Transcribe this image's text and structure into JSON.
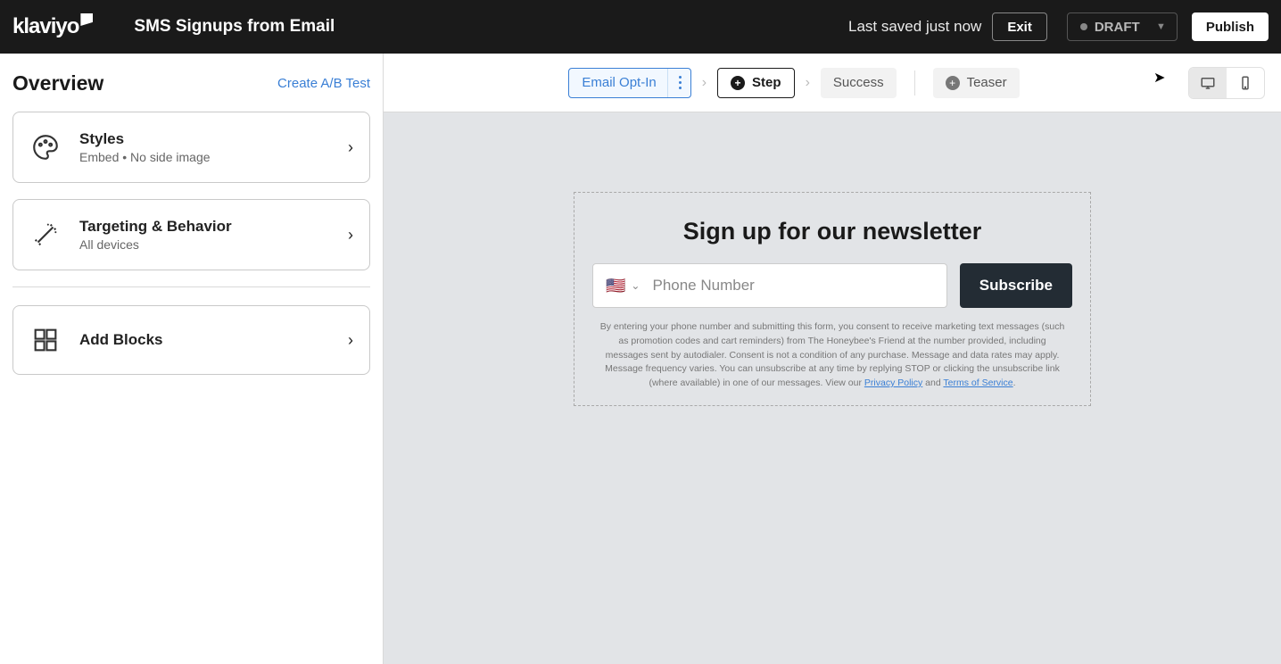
{
  "header": {
    "logo_text": "klaviyo",
    "title": "SMS Signups from Email",
    "saved_text": "Last saved just now",
    "exit_label": "Exit",
    "status_label": "DRAFT",
    "publish_label": "Publish"
  },
  "sidebar": {
    "title": "Overview",
    "ab_link": "Create A/B Test",
    "cards": [
      {
        "title": "Styles",
        "subtitle": "Embed • No side image"
      },
      {
        "title": "Targeting & Behavior",
        "subtitle": "All devices"
      },
      {
        "title": "Add Blocks",
        "subtitle": ""
      }
    ]
  },
  "steps": {
    "email_opt": "Email Opt-In",
    "step_label": "Step",
    "success_label": "Success",
    "teaser_label": "Teaser"
  },
  "form": {
    "heading": "Sign up for our newsletter",
    "phone_placeholder": "Phone Number",
    "subscribe_label": "Subscribe",
    "legal_prefix": "By entering your phone number and submitting this form, you consent to receive marketing text messages (such as promotion codes and cart reminders) from The Honeybee's Friend at the number provided, including messages sent by autodialer. Consent is not a condition of any purchase. Message and data rates may apply. Message frequency varies. You can unsubscribe at any time by replying STOP or clicking the unsubscribe link (where available) in one of our messages. View our ",
    "privacy_label": "Privacy Policy",
    "and_text": " and ",
    "terms_label": "Terms of Service",
    "period": "."
  }
}
